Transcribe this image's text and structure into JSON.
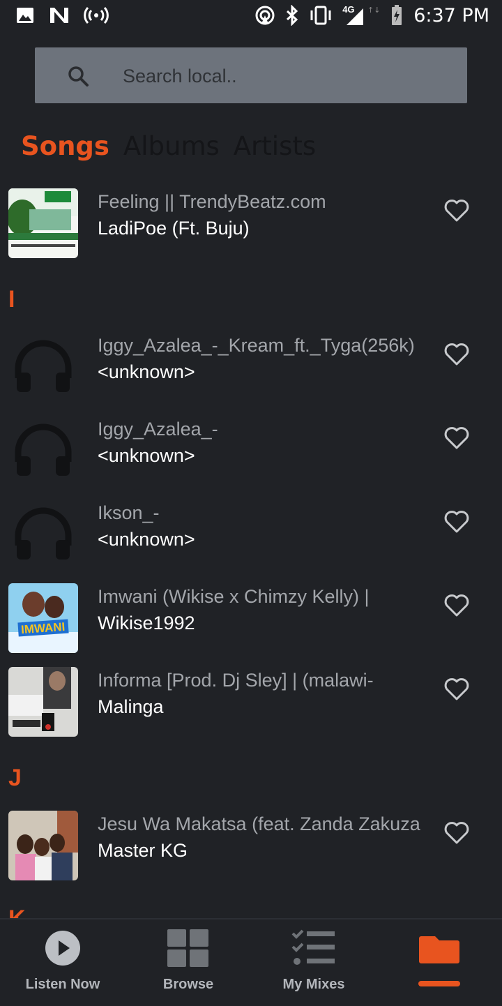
{
  "status_bar": {
    "time": "6:37 PM",
    "network": "4G"
  },
  "search": {
    "placeholder": "Search local.."
  },
  "tabs": [
    {
      "label": "Songs",
      "active": true
    },
    {
      "label": "Albums",
      "active": false
    },
    {
      "label": "Artists",
      "active": false
    }
  ],
  "sections": [
    {
      "letter": "I"
    },
    {
      "letter": "J"
    },
    {
      "letter": "K"
    }
  ],
  "songs": [
    {
      "title": "Feeling || TrendyBeatz.com",
      "artist": "LadiPoe (Ft. Buju)",
      "thumb": "album-art"
    },
    {
      "title": "Iggy_Azalea_-_Kream_ft._Tyga(256k)",
      "artist": "<unknown>",
      "thumb": "headphones-icon"
    },
    {
      "title": "Iggy_Azalea_-",
      "artist": "<unknown>",
      "thumb": "headphones-icon"
    },
    {
      "title": "Ikson_-",
      "artist": "<unknown>",
      "thumb": "headphones-icon"
    },
    {
      "title": "Imwani (Wikise x Chimzy Kelly)  |",
      "artist": "Wikise1992",
      "thumb": "album-art"
    },
    {
      "title": "Informa [Prod. Dj Sley] | (malawi-",
      "artist": "Malinga",
      "thumb": "album-art"
    },
    {
      "title": "Jesu Wa Makatsa (feat. Zanda Zakuza",
      "artist": "Master KG",
      "thumb": "album-art"
    }
  ],
  "bottom_nav": [
    {
      "label": "Listen Now",
      "icon": "play-circle-icon"
    },
    {
      "label": "Browse",
      "icon": "grid-icon"
    },
    {
      "label": "My Mixes",
      "icon": "checklist-icon"
    },
    {
      "label": "",
      "icon": "folder-icon",
      "active": true
    }
  ],
  "colors": {
    "accent": "#e8541f",
    "background": "#202226",
    "search_bg": "#6d737c"
  }
}
